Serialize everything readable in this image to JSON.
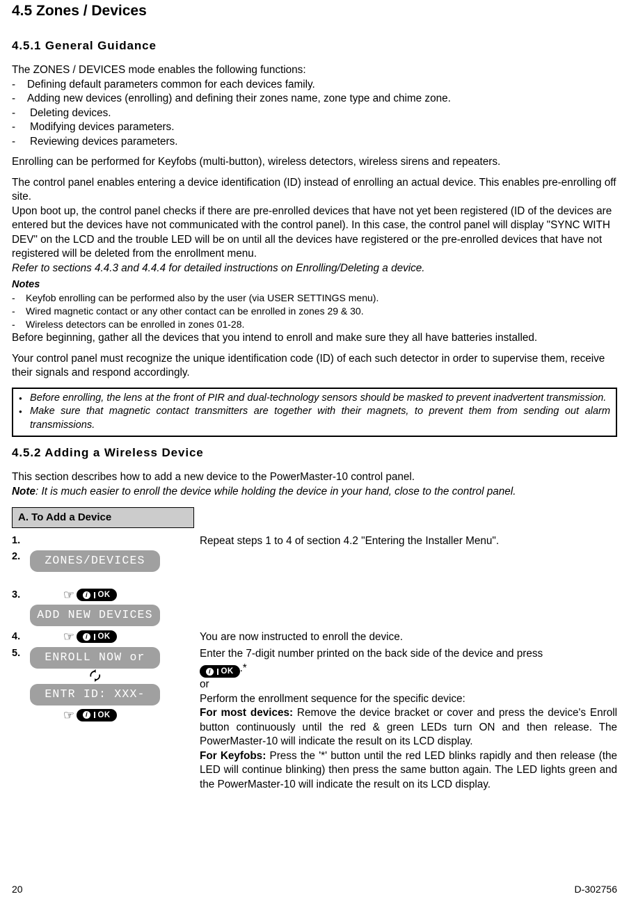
{
  "section": {
    "title": "4.5 Zones / Devices",
    "subsection_1_title": "4.5.1 General Guidance",
    "subsection_2_title": "4.5.2 Adding a Wireless Device"
  },
  "general_guidance": {
    "intro": "The ZONES / DEVICES mode enables the following functions:",
    "dash": "-",
    "functions": [
      "Defining default parameters common for each devices family.",
      "Adding new devices (enrolling) and defining their zones name, zone type and chime zone.",
      "Deleting devices.",
      "Modifying devices parameters.",
      "Reviewing devices parameters."
    ],
    "para_enrolling": "Enrolling can be performed for Keyfobs (multi-button), wireless detectors, wireless sirens and repeaters.",
    "para_preenroll": "The control panel enables entering a device identification (ID) instead of enrolling an actual device. This enables pre-enrolling off site.",
    "para_bootup": "Upon boot up, the control panel checks if there are pre-enrolled devices that have not yet been registered (ID of the devices are entered but the devices have not communicated with the control panel). In this case, the control panel will display \"SYNC WITH DEV\" on the LCD and the trouble LED will be on until all the devices have registered or the pre-enrolled devices that have not registered will be deleted from the enrollment menu.",
    "para_refer": "Refer to sections 4.4.3 and 4.4.4 for detailed instructions on Enrolling/Deleting a device.",
    "notes_heading": "Notes",
    "notes": [
      "Keyfob enrolling can be performed also by the user (via USER SETTINGS menu).",
      "Wired magnetic contact or any other contact can be enrolled in zones 29 & 30.",
      "Wireless detectors can be enrolled in zones 01-28."
    ],
    "para_before_beginning": "Before beginning, gather all the devices that you intend to enroll and make sure they all have batteries installed.",
    "para_recognize": "Your control panel must recognize the unique identification code (ID) of each such detector in order to supervise them, receive their signals and respond accordingly."
  },
  "warning_box": {
    "bullet_glyph": "•",
    "items": [
      "Before enrolling, the lens at the front of PIR and dual-technology sensors should be masked to prevent inadvertent transmission.",
      "Make sure that magnetic contact transmitters are together with their magnets, to prevent them from sending out alarm transmissions."
    ]
  },
  "adding_device": {
    "intro": "This section describes how to add a new device to the PowerMaster-10 control panel.",
    "note_label": "Note",
    "note_text": ": It is much easier to enroll the device while holding the device in your hand, close to the control panel.",
    "procedure_header": "A. To Add a Device"
  },
  "icons": {
    "hand_pointing": "☞",
    "cycle_arrows": "↺",
    "info_glyph": "i",
    "ok_label": "OK"
  },
  "steps": [
    {
      "number": "1.",
      "lcd": null,
      "right": "Repeat steps 1 to 4 of section 4.2 \"Entering the Installer Menu\"."
    },
    {
      "number": "2.",
      "lcd": "ZONES/DEVICES",
      "right": ""
    },
    {
      "number": "3.",
      "lcd": "ADD NEW DEVICES",
      "right": ""
    },
    {
      "number": "4.",
      "lcd": null,
      "right": "You are now instructed to enroll the device."
    },
    {
      "number": "5.",
      "lcd_top": "ENROLL NOW or",
      "lcd_bottom": "ENTR ID: XXX-",
      "right_line_1a": "Enter the 7-digit number printed on the back side of the device and press",
      "right_line_1b": ".*",
      "right_or": "or",
      "right_perform": "Perform the enrollment sequence for the specific device:",
      "most_devices_label": "For most devices:",
      "most_devices_text": " Remove the device bracket or cover and press the device's Enroll button continuously until the red & green LEDs turn ON and then release. The PowerMaster-10 will indicate the result on its LCD display.",
      "keyfobs_label": "For Keyfobs:",
      "keyfobs_text": " Press the '*' button until the red LED blinks rapidly and then release (the LED will continue blinking) then press the same button again. The LED lights green and the PowerMaster-10 will indicate the result on its LCD display."
    }
  ],
  "footer": {
    "page_number": "20",
    "doc_id": "D-302756"
  },
  "colors": {
    "lcd_bg": "#a0a0a0",
    "lcd_text": "#ffffff",
    "key_bg": "#000000",
    "header_bg": "#cccccc"
  }
}
